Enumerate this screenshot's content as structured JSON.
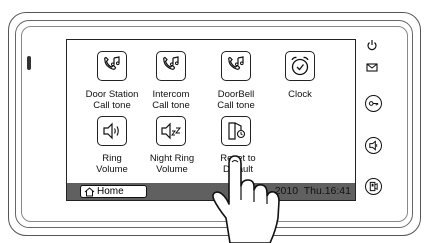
{
  "menu": {
    "items": [
      {
        "label_line1": "Door Station",
        "label_line2": "Call tone",
        "icon": "phone-music-icon"
      },
      {
        "label_line1": "Intercom",
        "label_line2": "Call tone",
        "icon": "phone-music-icon"
      },
      {
        "label_line1": "DoorBell",
        "label_line2": "Call tone",
        "icon": "phone-music-icon"
      },
      {
        "label_line1": "Clock",
        "label_line2": "",
        "icon": "alarm-clock-icon"
      },
      {
        "label_line1": "Ring",
        "label_line2": "Volume",
        "icon": "speaker-volume-icon"
      },
      {
        "label_line1": "Night Ring",
        "label_line2": "Volume",
        "icon": "speaker-sleep-icon"
      },
      {
        "label_line1": "Reset to",
        "label_line2": "Default",
        "icon": "reset-icon"
      }
    ]
  },
  "status_bar": {
    "home_label": "Home",
    "datetime": "0    2010  Thu.16:41"
  },
  "side_buttons": [
    "power-icon",
    "mail-icon",
    "key-icon",
    "unlock-icon",
    "monitor-icon"
  ],
  "colors": {
    "status_bar": "#606060",
    "outline": "#222222"
  }
}
